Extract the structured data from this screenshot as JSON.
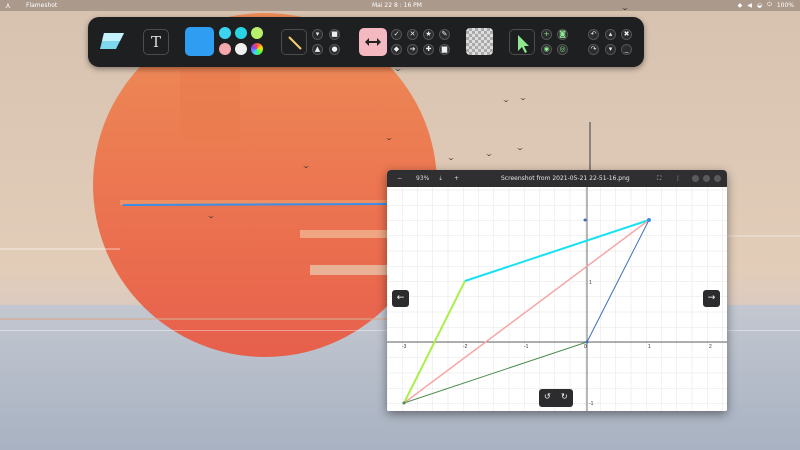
{
  "topbar": {
    "activities_icon": "activities-icon",
    "app_name": "Flameshot",
    "clock": "Mai 22  8 : 16 PM",
    "battery": "100%",
    "tray_icons": [
      "notification-icon",
      "volume-icon",
      "network-icon",
      "power-icon"
    ]
  },
  "toolbar": {
    "logo": "flameshot-logo",
    "text_tool_label": "T",
    "colors": {
      "selected": "#2f9df2",
      "palette": [
        "#3dd3f0",
        "#2bd4e4",
        "#b8f06c",
        "#f6a9ad",
        "#f0f0f0",
        "multicolor"
      ]
    },
    "tools": [
      "line",
      "marker",
      "rectangle",
      "triangle",
      "circle",
      "arrow-double",
      "check",
      "cross",
      "star",
      "pencil",
      "eraser",
      "arrow-right",
      "blur",
      "pin",
      "delete"
    ],
    "active_tool": "arrow-double",
    "actions": [
      "select",
      "add",
      "screenshot",
      "undo",
      "move-up",
      "close",
      "redo",
      "move-down",
      "minimize"
    ]
  },
  "viewer": {
    "zoom_label": "93%",
    "minus_label": "−",
    "plus_label": "+",
    "title": "Screenshot from 2021-05-21 22-51-16.png",
    "prev_label": "←",
    "next_label": "→",
    "rotate_left_label": "↺",
    "rotate_right_label": "↻",
    "axis_x_ticks": [
      "-3",
      "-2",
      "-1",
      "0",
      "1",
      "2"
    ],
    "axis_y_ticks": [
      "1",
      "-1"
    ],
    "colors": {
      "cyan": "#16e2f0",
      "lime": "#a8f04a",
      "pink": "#f7a6a6",
      "green": "#4e8f52",
      "blue": "#3f6fb5",
      "annotation": "#3a8ee8"
    }
  }
}
